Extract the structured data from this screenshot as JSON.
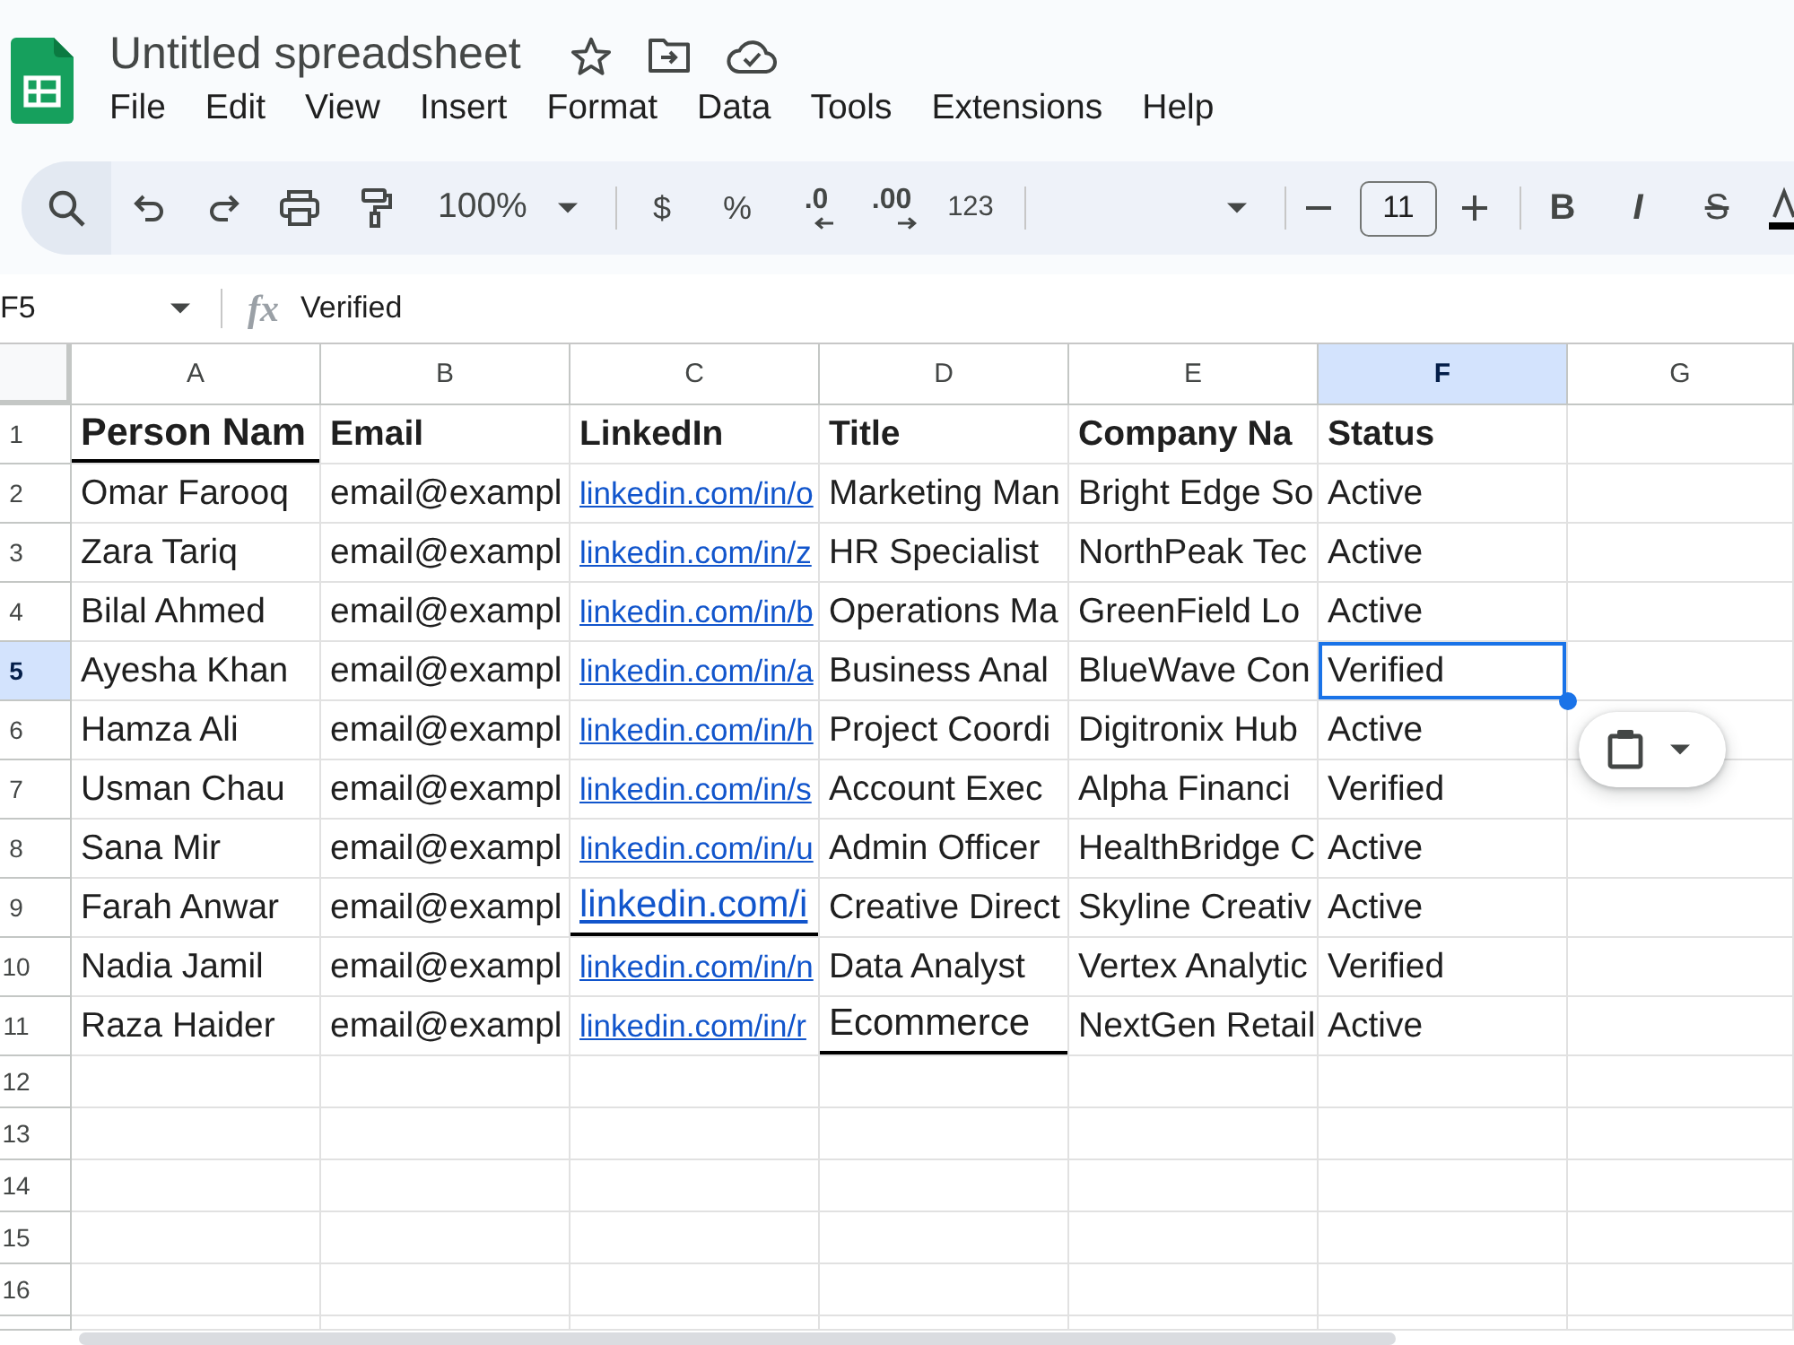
{
  "window": {
    "title": "Untitled spreadsheet"
  },
  "menu": [
    "File",
    "Edit",
    "View",
    "Insert",
    "Format",
    "Data",
    "Tools",
    "Extensions",
    "Help"
  ],
  "toolbar": {
    "zoom": "100%",
    "currency": "$",
    "percent": "%",
    "decrease_decimals": ".0",
    "increase_decimals": ".00",
    "number_formats": "123",
    "font_size": "11",
    "bold": "B",
    "italic": "I",
    "strikethrough": "S"
  },
  "formula_bar": {
    "cell_ref": "F5",
    "fx": "fx",
    "value": "Verified"
  },
  "sheet": {
    "columns": [
      {
        "letter": "A",
        "selected": false
      },
      {
        "letter": "B",
        "selected": false
      },
      {
        "letter": "C",
        "selected": false
      },
      {
        "letter": "D",
        "selected": false
      },
      {
        "letter": "E",
        "selected": false
      },
      {
        "letter": "F",
        "selected": true
      },
      {
        "letter": "G",
        "selected": false
      }
    ],
    "rows": [
      {
        "number": "1",
        "selected": false,
        "cells": [
          {
            "text": "Person Nam",
            "kind": "large_header",
            "selected": false,
            "border_bottom": true
          },
          {
            "text": "Email",
            "kind": "header",
            "selected": false,
            "border_bottom": false
          },
          {
            "text": "LinkedIn",
            "kind": "header",
            "selected": false,
            "border_bottom": false
          },
          {
            "text": "Title",
            "kind": "header",
            "selected": false,
            "border_bottom": false
          },
          {
            "text": "Company Na",
            "kind": "header",
            "selected": false,
            "border_bottom": false
          },
          {
            "text": "Status",
            "kind": "header",
            "selected": false,
            "border_bottom": false
          }
        ]
      },
      {
        "number": "2",
        "selected": false,
        "cells": [
          {
            "text": "Omar Farooq",
            "kind": "text",
            "selected": false,
            "border_bottom": false
          },
          {
            "text": "email@exampl",
            "kind": "text",
            "selected": false,
            "border_bottom": false
          },
          {
            "text": "linkedin.com/in/o",
            "kind": "link",
            "selected": false,
            "border_bottom": false
          },
          {
            "text": "Marketing Man",
            "kind": "text",
            "selected": false,
            "border_bottom": false
          },
          {
            "text": "Bright Edge So",
            "kind": "text",
            "selected": false,
            "border_bottom": false
          },
          {
            "text": "Active",
            "kind": "text",
            "selected": false,
            "border_bottom": false
          }
        ]
      },
      {
        "number": "3",
        "selected": false,
        "cells": [
          {
            "text": "Zara Tariq",
            "kind": "text",
            "selected": false,
            "border_bottom": false
          },
          {
            "text": "email@exampl",
            "kind": "text",
            "selected": false,
            "border_bottom": false
          },
          {
            "text": "linkedin.com/in/z",
            "kind": "link",
            "selected": false,
            "border_bottom": false
          },
          {
            "text": "HR Specialist",
            "kind": "text",
            "selected": false,
            "border_bottom": false
          },
          {
            "text": "NorthPeak Tec",
            "kind": "text",
            "selected": false,
            "border_bottom": false
          },
          {
            "text": "Active",
            "kind": "text",
            "selected": false,
            "border_bottom": false
          }
        ]
      },
      {
        "number": "4",
        "selected": false,
        "cells": [
          {
            "text": "Bilal Ahmed",
            "kind": "text",
            "selected": false,
            "border_bottom": false
          },
          {
            "text": "email@exampl",
            "kind": "text",
            "selected": false,
            "border_bottom": false
          },
          {
            "text": "linkedin.com/in/b",
            "kind": "link",
            "selected": false,
            "border_bottom": false
          },
          {
            "text": "Operations Ma",
            "kind": "text",
            "selected": false,
            "border_bottom": false
          },
          {
            "text": "GreenField Lo",
            "kind": "text",
            "selected": false,
            "border_bottom": false
          },
          {
            "text": "Active",
            "kind": "text",
            "selected": false,
            "border_bottom": false
          }
        ]
      },
      {
        "number": "5",
        "selected": true,
        "cells": [
          {
            "text": "Ayesha Khan",
            "kind": "text",
            "selected": false,
            "border_bottom": false
          },
          {
            "text": "email@exampl",
            "kind": "text",
            "selected": false,
            "border_bottom": false
          },
          {
            "text": "linkedin.com/in/a",
            "kind": "link",
            "selected": false,
            "border_bottom": false
          },
          {
            "text": "Business Anal",
            "kind": "text",
            "selected": false,
            "border_bottom": false
          },
          {
            "text": "BlueWave Con",
            "kind": "text",
            "selected": false,
            "border_bottom": false
          },
          {
            "text": "Verified",
            "kind": "text",
            "selected": true,
            "border_bottom": false
          }
        ]
      },
      {
        "number": "6",
        "selected": false,
        "cells": [
          {
            "text": "Hamza Ali",
            "kind": "text",
            "selected": false,
            "border_bottom": false
          },
          {
            "text": "email@exampl",
            "kind": "text",
            "selected": false,
            "border_bottom": false
          },
          {
            "text": "linkedin.com/in/h",
            "kind": "link",
            "selected": false,
            "border_bottom": false
          },
          {
            "text": "Project Coordi",
            "kind": "text",
            "selected": false,
            "border_bottom": false
          },
          {
            "text": "Digitronix Hub",
            "kind": "text",
            "selected": false,
            "border_bottom": false
          },
          {
            "text": "Active",
            "kind": "text",
            "selected": false,
            "border_bottom": false
          }
        ]
      },
      {
        "number": "7",
        "selected": false,
        "cells": [
          {
            "text": "Usman Chau",
            "kind": "text",
            "selected": false,
            "border_bottom": false
          },
          {
            "text": "email@exampl",
            "kind": "text",
            "selected": false,
            "border_bottom": false
          },
          {
            "text": "linkedin.com/in/s",
            "kind": "link",
            "selected": false,
            "border_bottom": false
          },
          {
            "text": "Account Exec",
            "kind": "text",
            "selected": false,
            "border_bottom": false
          },
          {
            "text": "Alpha Financi",
            "kind": "text",
            "selected": false,
            "border_bottom": false
          },
          {
            "text": "Verified",
            "kind": "text",
            "selected": false,
            "border_bottom": false
          }
        ]
      },
      {
        "number": "8",
        "selected": false,
        "cells": [
          {
            "text": "Sana Mir",
            "kind": "text",
            "selected": false,
            "border_bottom": false
          },
          {
            "text": "email@exampl",
            "kind": "text",
            "selected": false,
            "border_bottom": false
          },
          {
            "text": "linkedin.com/in/u",
            "kind": "link",
            "selected": false,
            "border_bottom": false
          },
          {
            "text": "Admin Officer",
            "kind": "text",
            "selected": false,
            "border_bottom": false
          },
          {
            "text": "HealthBridge C",
            "kind": "text",
            "selected": false,
            "border_bottom": false
          },
          {
            "text": "Active",
            "kind": "text",
            "selected": false,
            "border_bottom": false
          }
        ]
      },
      {
        "number": "9",
        "selected": false,
        "cells": [
          {
            "text": "Farah Anwar",
            "kind": "text",
            "selected": false,
            "border_bottom": false
          },
          {
            "text": "email@exampl",
            "kind": "text",
            "selected": false,
            "border_bottom": false
          },
          {
            "text": "linkedin.com/i",
            "kind": "large_link",
            "selected": false,
            "border_bottom": true
          },
          {
            "text": "Creative Direct",
            "kind": "text",
            "selected": false,
            "border_bottom": false
          },
          {
            "text": "Skyline Creativ",
            "kind": "text",
            "selected": false,
            "border_bottom": false
          },
          {
            "text": "Active",
            "kind": "text",
            "selected": false,
            "border_bottom": false
          }
        ]
      },
      {
        "number": "10",
        "selected": false,
        "cells": [
          {
            "text": "Nadia Jamil",
            "kind": "text",
            "selected": false,
            "border_bottom": false
          },
          {
            "text": "email@exampl",
            "kind": "text",
            "selected": false,
            "border_bottom": false
          },
          {
            "text": "linkedin.com/in/n",
            "kind": "link",
            "selected": false,
            "border_bottom": false
          },
          {
            "text": "Data Analyst",
            "kind": "text",
            "selected": false,
            "border_bottom": false
          },
          {
            "text": "Vertex Analytic",
            "kind": "text",
            "selected": false,
            "border_bottom": false
          },
          {
            "text": "Verified",
            "kind": "text",
            "selected": false,
            "border_bottom": false
          }
        ]
      },
      {
        "number": "11",
        "selected": false,
        "cells": [
          {
            "text": "Raza Haider",
            "kind": "text",
            "selected": false,
            "border_bottom": false
          },
          {
            "text": "email@exampl",
            "kind": "text",
            "selected": false,
            "border_bottom": false
          },
          {
            "text": "linkedin.com/in/r",
            "kind": "link",
            "selected": false,
            "border_bottom": false
          },
          {
            "text": "Ecommerce",
            "kind": "large_text",
            "selected": false,
            "border_bottom": true
          },
          {
            "text": "NextGen Retail",
            "kind": "text",
            "selected": false,
            "border_bottom": false
          },
          {
            "text": "Active",
            "kind": "text",
            "selected": false,
            "border_bottom": false
          }
        ]
      },
      {
        "number": "12",
        "selected": false,
        "cells": []
      },
      {
        "number": "13",
        "selected": false,
        "cells": []
      },
      {
        "number": "14",
        "selected": false,
        "cells": []
      },
      {
        "number": "15",
        "selected": false,
        "cells": []
      },
      {
        "number": "16",
        "selected": false,
        "cells": []
      }
    ]
  }
}
